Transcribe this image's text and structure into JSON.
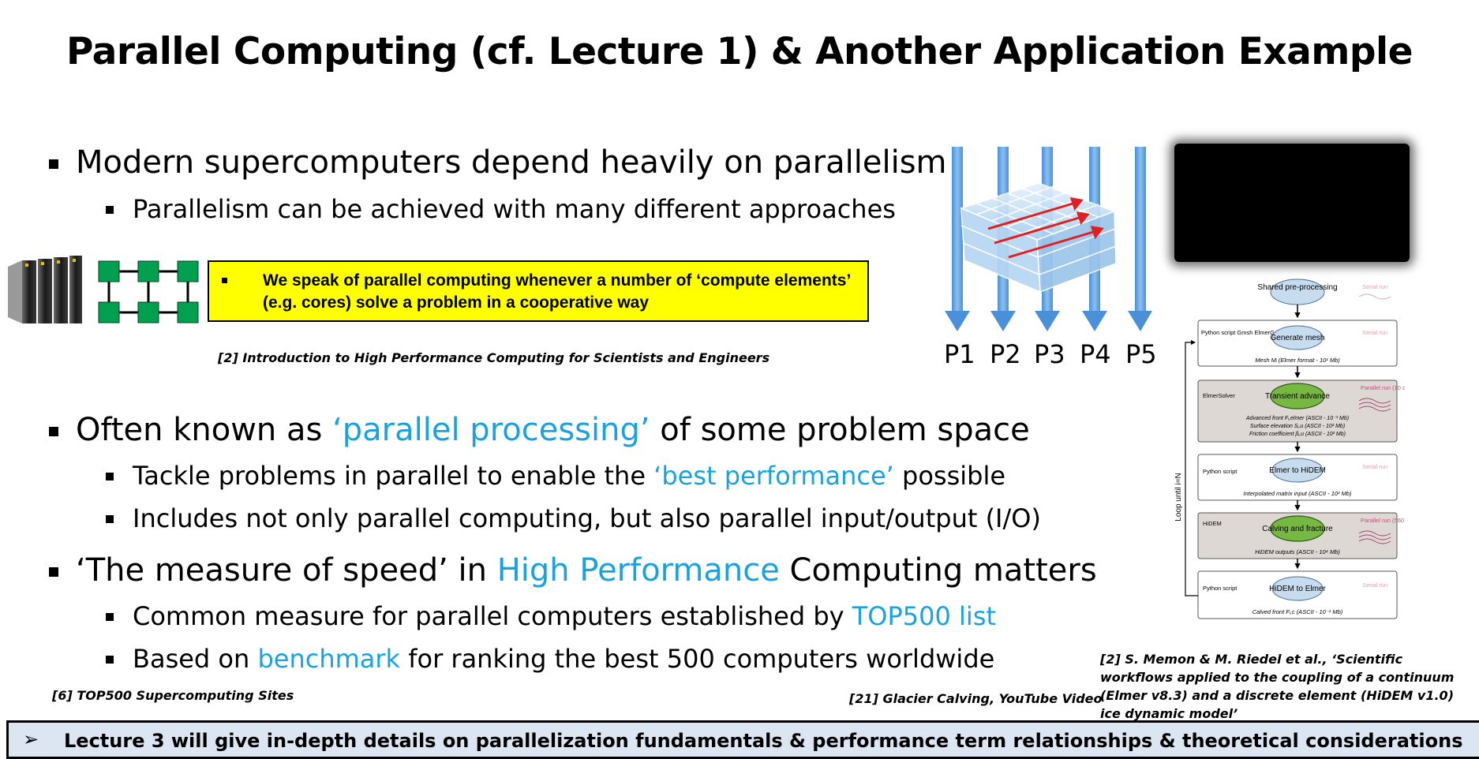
{
  "title": "Parallel Computing (cf. Lecture 1) & Another Application Example",
  "bullets": {
    "b1": "Modern supercomputers depend heavily on parallelism",
    "b1_1": "Parallelism can be achieved with many different approaches",
    "b2_pre": "Often known as ",
    "b2_hl": "‘parallel processing’",
    "b2_post": " of some problem space",
    "b2_1_pre": "Tackle problems in parallel to enable the ",
    "b2_1_hl": "‘best performance’",
    "b2_1_post": " possible",
    "b2_2": "Includes not only parallel computing, but also parallel input/output (I/O)",
    "b3_pre": "‘The measure of speed’ in ",
    "b3_hl": "High Performance",
    "b3_post": " Computing matters",
    "b3_1_pre": "Common measure for parallel computers established by ",
    "b3_1_hl": "TOP500 list",
    "b3_2_pre": "Based on ",
    "b3_2_hl": "benchmark",
    "b3_2_post": " for ranking the best 500 computers worldwide"
  },
  "definition_box": "We speak of parallel computing whenever a number of ‘compute elements’ (e.g. cores) solve a problem in a cooperative way",
  "references": {
    "ref_intro": "[2] Introduction to High Performance Computing for Scientists and Engineers",
    "ref_top500": "[6] TOP500 Supercomputing Sites",
    "ref_glacier": "[21] Glacier Calving, YouTube Video",
    "ref_memon": "[2] S. Memon & M. Riedel et al., ‘Scientific workflows applied to the coupling of a continuum (Elmer v8.3) and a discrete element (HiDEM v1.0) ice dynamic model’"
  },
  "processors": [
    "P1",
    "P2",
    "P3",
    "P4",
    "P5"
  ],
  "workflow": {
    "shared": "Shared pre-processing",
    "serial_run": "Serial run",
    "parallel_run_10": "Parallel run (10 cores)",
    "parallel_run_560": "Parallel run (560 cores)",
    "loop": "Loop until i=N",
    "step1_tool": "Python script Gmsh ElmerGrid",
    "step1_node": "Generate mesh",
    "step1_out": "Mesh Mᵢ (Elmer format - 10¹ Mb)",
    "step2_tool": "ElmerSolver",
    "step2_node": "Transient advance",
    "step2_out1": "Advanced front Fᵢ,elmer (ASCII - 10⁻³ Mb)",
    "step2_out2": "Surface elevation Sᵢ,u (ASCII - 10² Mb)",
    "step2_out3": "Friction coefficient βᵢ,u (ASCII - 10² Mb)",
    "step3_tool": "Python script",
    "step3_node": "Elmer to HiDEM",
    "step3_out": "Interpolated matrix input (ASCII - 10² Mb)",
    "step4_tool": "HiDEM",
    "step4_node": "Calving and fracture",
    "step4_out": "HiDEM outputs (ASCII - 10⁴ Mb)",
    "step5_tool": "Python script",
    "step5_node": "HiDEM to Elmer",
    "step5_out": "Calved front Fᵢ,c (ASCII - 10⁻¹ Mb)"
  },
  "bottom_bar": "Lecture 3 will give in-depth details on parallelization fundamentals & performance term relationships & theoretical considerations",
  "bottom_arrow": "➢",
  "colors": {
    "highlight_blue": "#18a3e0",
    "definition_box": "#ffff00",
    "bottom_bar": "#dce6f2",
    "network_node": "#00a050",
    "workflow_green": "#77b843",
    "workflow_blue_node": "#c7dcef",
    "workflow_box_shaded": "#ded8d4"
  }
}
